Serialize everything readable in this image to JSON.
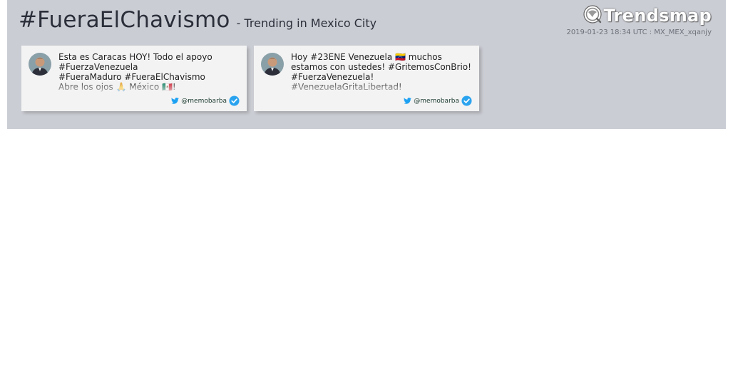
{
  "header": {
    "hashtag": "#FueraElChavismo",
    "subtitle": "- Trending in Mexico City",
    "meta": "2019-01-23 18:34 UTC : MX_MEX_xqanjy",
    "logo_text": "Trendsmap",
    "logo_icon": "trendsmap-globe-icon"
  },
  "colors": {
    "banner_bg": "#cbcdd4",
    "card_bg": "#f3f3f4",
    "twitter_blue": "#1da1f2",
    "verified": "#2aa3ef"
  },
  "tweets": [
    {
      "lines": [
        "Esta es Caracas HOY! Todo el apoyo",
        "#FuerzaVenezuela",
        "#FueraMaduro #FueraElChavismo",
        "Abre los ojos 🙏 México 🇲🇽!"
      ],
      "handle": "@memobarba"
    },
    {
      "lines": [
        "Hoy #23ENE Venezuela 🇻🇪 muchos",
        "estamos con ustedes! #GritemosConBrio!",
        "#FuerzaVenezuela!",
        "#VenezuelaGritaLibertad!"
      ],
      "handle": "@memobarba"
    }
  ]
}
